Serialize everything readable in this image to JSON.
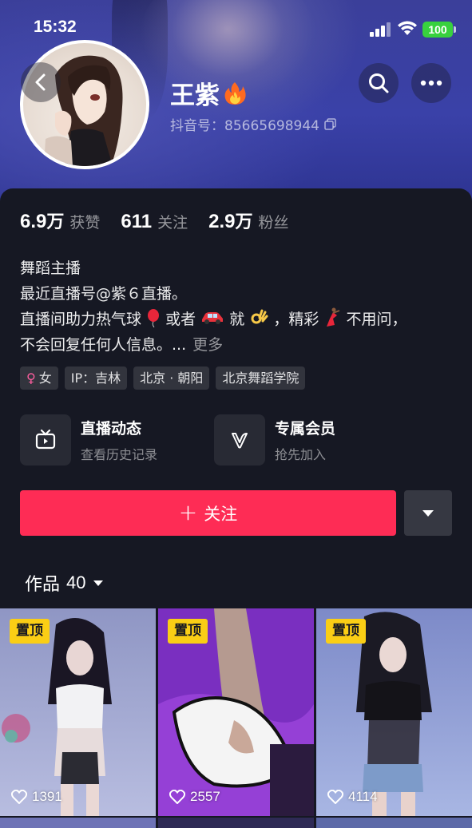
{
  "status_bar": {
    "time": "15:32",
    "battery": "100"
  },
  "profile": {
    "name": "王紫",
    "account_id": "抖音号：85665698944"
  },
  "stats": [
    {
      "value": "6.9",
      "unit": "万",
      "label": "获赞"
    },
    {
      "value": "611",
      "unit": "",
      "label": "关注"
    },
    {
      "value": "2.9",
      "unit": "万",
      "label": "粉丝"
    }
  ],
  "bio": {
    "line1": "舞蹈主播",
    "line2": "最近直播号@紫６直播。",
    "line3_a": "直播间助力热气球",
    "line3_b": "或者",
    "line3_c": "就",
    "line3_d": "，精彩",
    "line3_e": "不用问，",
    "line4": "不会回复任何人信息。...",
    "more": "更多"
  },
  "tags": [
    {
      "label": "女"
    },
    {
      "label": "IP：吉林"
    },
    {
      "label": "北京 · 朝阳"
    },
    {
      "label": "北京舞蹈学院"
    }
  ],
  "shortcuts": [
    {
      "title": "直播动态",
      "subtitle": "查看历史记录",
      "icon": "tv-icon"
    },
    {
      "title": "专属会员",
      "subtitle": "抢先加入",
      "icon": "v-icon"
    }
  ],
  "follow_label": "关注",
  "works_tab": {
    "label": "作品",
    "count": "40"
  },
  "videos": [
    {
      "pin": "置顶",
      "likes": "1391"
    },
    {
      "pin": "置顶",
      "likes": "2557"
    },
    {
      "pin": "置顶",
      "likes": "4114"
    }
  ],
  "colors": {
    "accent": "#fe2c55",
    "background": "#161823",
    "pin": "#face15"
  }
}
